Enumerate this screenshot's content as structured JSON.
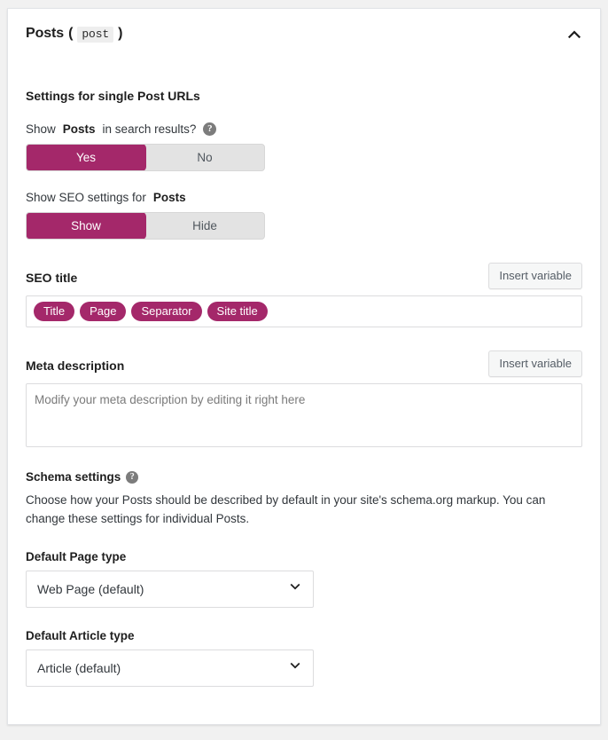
{
  "accent_color": "#a4286a",
  "panel": {
    "title": "Posts",
    "paren_open": "(",
    "code_badge": "post",
    "paren_close": ")",
    "collapse_icon": "chevron-up-icon",
    "section_heading": "Settings for single Post URLs"
  },
  "search_results_field": {
    "label_prefix": "Show",
    "label_bold": "Posts",
    "label_suffix": "in search results?",
    "help_icon": "help-circle-icon",
    "options": [
      "Yes",
      "No"
    ],
    "selected": "Yes"
  },
  "seo_settings_field": {
    "label_prefix": "Show SEO settings for",
    "label_bold": "Posts",
    "options": [
      "Show",
      "Hide"
    ],
    "selected": "Show"
  },
  "seo_title": {
    "label": "SEO title",
    "insert_variable_label": "Insert variable",
    "pills": [
      "Title",
      "Page",
      "Separator",
      "Site title"
    ]
  },
  "meta_description": {
    "label": "Meta description",
    "insert_variable_label": "Insert variable",
    "placeholder": "Modify your meta description by editing it right here",
    "value": ""
  },
  "schema": {
    "heading": "Schema settings",
    "help_icon": "help-circle-icon",
    "description": "Choose how your Posts should be described by default in your site's schema.org markup. You can change these settings for individual Posts.",
    "page_type": {
      "label": "Default Page type",
      "selected": "Web Page (default)",
      "chevron_icon": "chevron-down-icon"
    },
    "article_type": {
      "label": "Default Article type",
      "selected": "Article (default)",
      "chevron_icon": "chevron-down-icon"
    }
  }
}
